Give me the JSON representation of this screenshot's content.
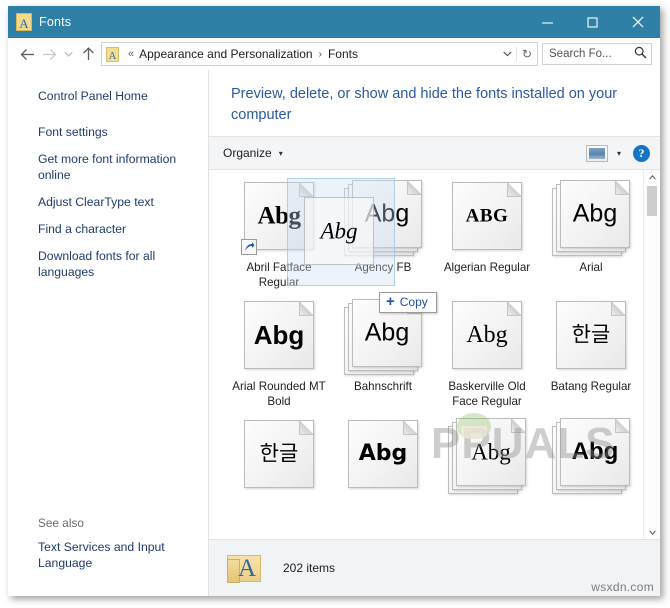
{
  "window": {
    "title": "Fonts",
    "title_icon": "font-folder-icon",
    "controls": {
      "minimize": "minimize-icon",
      "maximize": "maximize-icon",
      "close": "close-icon"
    }
  },
  "navbar": {
    "back": "back-arrow-icon",
    "forward": "forward-arrow-icon",
    "recent": "chevron-down-icon",
    "up": "up-arrow-icon",
    "breadcrumb": {
      "root_chevron": "«",
      "items": [
        "Appearance and Personalization",
        "Fonts"
      ],
      "separator": "›"
    },
    "address_dropdown": "chevron-down-icon",
    "refresh": "↻",
    "search": {
      "placeholder": "Search Fo...",
      "icon": "search-icon"
    }
  },
  "sidebar": {
    "home_link": "Control Panel Home",
    "links": [
      "Font settings",
      "Get more font information online",
      "Adjust ClearType text",
      "Find a character",
      "Download fonts for all languages"
    ],
    "see_also_title": "See also",
    "see_also_links": [
      "Text Services and Input Language"
    ]
  },
  "content": {
    "heading": "Preview, delete, or show and hide the fonts installed on your computer",
    "toolbar": {
      "organize_label": "Organize",
      "organize_caret": "▾",
      "view_icon": "view-layout-icon",
      "view_caret": "▾",
      "help_label": "?"
    }
  },
  "drag": {
    "tooltip_label": "Copy",
    "tooltip_plus": "+",
    "ghost_sample": "Abg"
  },
  "fonts": {
    "rows": [
      [
        {
          "name": "Abril Fatface Regular",
          "sample": "Abg",
          "style": "s-fatface",
          "stacked": false,
          "shortcut": true
        },
        {
          "name": "Agency FB",
          "sample": "Abg",
          "style": "s-arial",
          "stacked": true,
          "shortcut": false
        },
        {
          "name": "Algerian Regular",
          "sample": "ABG",
          "style": "s-algerian",
          "stacked": false,
          "shortcut": false
        },
        {
          "name": "Arial",
          "sample": "Abg",
          "style": "s-arial",
          "stacked": true,
          "shortcut": false
        }
      ],
      [
        {
          "name": "Arial Rounded MT Bold",
          "sample": "Abg",
          "style": "s-round",
          "stacked": false,
          "shortcut": false
        },
        {
          "name": "Bahnschrift",
          "sample": "Abg",
          "style": "s-bahn",
          "stacked": true,
          "shortcut": false
        },
        {
          "name": "Baskerville Old Face Regular",
          "sample": "Abg",
          "style": "s-bask",
          "stacked": false,
          "shortcut": false
        },
        {
          "name": "Batang Regular",
          "sample": "한글",
          "style": "s-hangul",
          "stacked": false,
          "shortcut": false
        }
      ],
      [
        {
          "name": "",
          "sample": "한글",
          "style": "s-hangul",
          "stacked": false,
          "shortcut": false
        },
        {
          "name": "",
          "sample": "Abg",
          "style": "s-bold",
          "stacked": false,
          "shortcut": false
        },
        {
          "name": "",
          "sample": "Abg",
          "style": "s-serif",
          "stacked": true,
          "shortcut": false
        },
        {
          "name": "",
          "sample": "Abg",
          "style": "s-sans-b",
          "stacked": true,
          "shortcut": false
        }
      ]
    ]
  },
  "statusbar": {
    "item_count": "202 items",
    "folder_icon": "fonts-folder-icon"
  },
  "watermarks": {
    "center": "PPUALS",
    "corner": "wsxdn.com"
  },
  "colors": {
    "titlebar": "#2e80a6",
    "link": "#1f3c6e",
    "heading": "#2b5aa0",
    "toolbar_bg": "#f3f5f7",
    "status_bg": "#f1f4f7",
    "help_blue": "#1475c6",
    "drop_tip_text": "#1c4fa1"
  }
}
